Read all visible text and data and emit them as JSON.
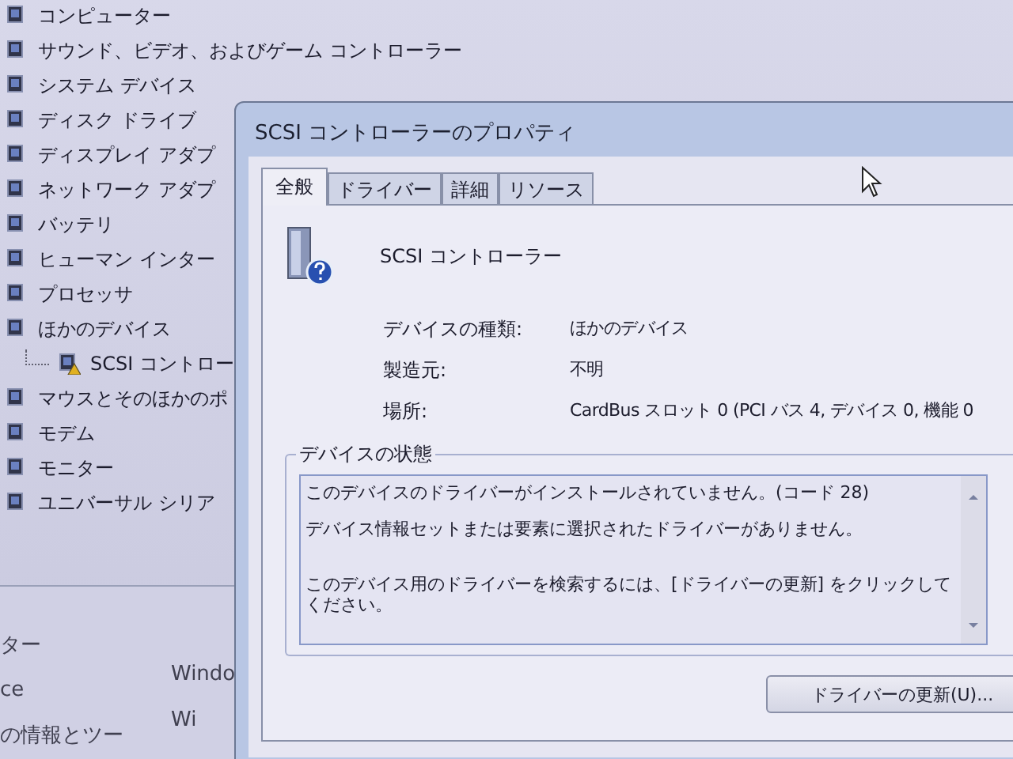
{
  "device_tree": {
    "items": [
      {
        "label": "コンピューター"
      },
      {
        "label": "サウンド、ビデオ、およびゲーム コントローラー"
      },
      {
        "label": "システム デバイス"
      },
      {
        "label": "ディスク ドライブ"
      },
      {
        "label": "ディスプレイ アダプ"
      },
      {
        "label": "ネットワーク アダプ"
      },
      {
        "label": "バッテリ"
      },
      {
        "label": "ヒューマン インター"
      },
      {
        "label": "プロセッサ"
      },
      {
        "label": "ほかのデバイス",
        "children": [
          {
            "label": "SCSI コントロー",
            "warning": true
          }
        ]
      },
      {
        "label": "マウスとそのほかのポ"
      },
      {
        "label": "モデム"
      },
      {
        "label": "モニター"
      },
      {
        "label": "ユニバーサル シリア"
      }
    ]
  },
  "lower_panel": {
    "texts": [
      "ター",
      "ce",
      "の情報とツー"
    ],
    "texts_right": [
      "Windo",
      "Wi"
    ]
  },
  "dialog": {
    "title": "SCSI コントローラーのプロパティ",
    "tabs": [
      {
        "label": "全般",
        "selected": true
      },
      {
        "label": "ドライバー",
        "selected": false
      },
      {
        "label": "詳細",
        "selected": false
      },
      {
        "label": "リソース",
        "selected": false
      }
    ],
    "device_name": "SCSI コントローラー",
    "properties": [
      {
        "label": "デバイスの種類:",
        "value": "ほかのデバイス"
      },
      {
        "label": "製造元:",
        "value": "不明"
      },
      {
        "label": "場所:",
        "value": "CardBus スロット 0 (PCI バス 4, デバイス 0, 機能 0"
      }
    ],
    "status_group": {
      "title": "デバイスの状態",
      "lines": [
        "このデバイスのドライバーがインストールされていません。(コード 28)",
        "デバイス情報セットまたは要素に選択されたドライバーがありません。",
        "このデバイス用のドライバーを検索するには、[ドライバーの更新] をクリックしてください。"
      ]
    },
    "button": "ドライバーの更新(U)..."
  }
}
